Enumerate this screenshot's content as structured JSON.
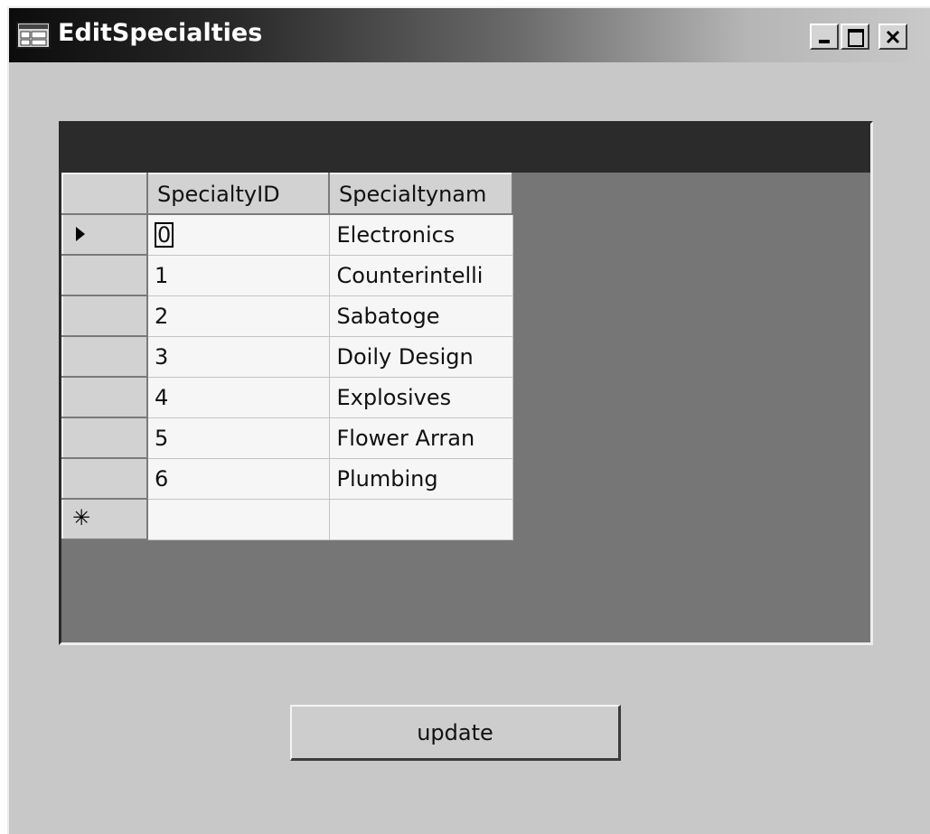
{
  "window": {
    "title": "EditSpecialties",
    "controls": {
      "minimize": "minimize",
      "maximize": "maximize",
      "close": "close"
    }
  },
  "grid": {
    "columns": [
      "SpecialtyID",
      "Specialtynam"
    ],
    "rows": [
      {
        "id": "0",
        "name": "Electronics",
        "current": true
      },
      {
        "id": "1",
        "name": "Counterintelli"
      },
      {
        "id": "2",
        "name": "Sabatoge"
      },
      {
        "id": "3",
        "name": "Doily Design"
      },
      {
        "id": "4",
        "name": "Explosives"
      },
      {
        "id": "5",
        "name": "Flower Arran"
      },
      {
        "id": "6",
        "name": "Plumbing"
      }
    ],
    "new_row_marker": "✳"
  },
  "buttons": {
    "update_label": "update"
  },
  "icons": {
    "app": "window-app-icon",
    "current_row": "row-pointer-icon",
    "new_row": "new-row-asterisk-icon"
  },
  "colors": {
    "form_background": "#c8c8c8",
    "grid_background": "#767676",
    "caption_bar": "#2b2b2b",
    "cell_background": "#f6f6f6",
    "header_background": "#d2d2d2"
  }
}
